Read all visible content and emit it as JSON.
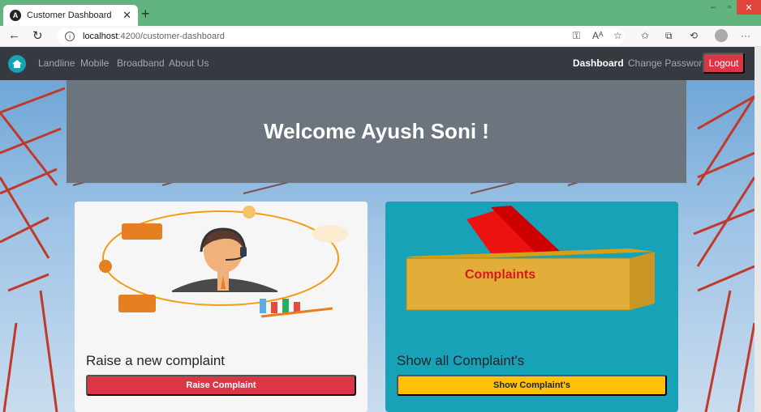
{
  "browser": {
    "tab_title": "Customer Dashboard",
    "tab_icon": "angular-icon",
    "url_host": "localhost",
    "url_path": ":4200/customer-dashboard"
  },
  "navbar": {
    "links": [
      "Landline",
      "Mobile",
      "Broadband",
      "About Us"
    ],
    "right_links": [
      "Dashboard",
      "Change Password"
    ],
    "logout_label": "Logout",
    "colors": {
      "bg": "#343a40",
      "logout": "#dc3545"
    }
  },
  "hero": {
    "welcome": "Welcome Ayush Soni !"
  },
  "cards": {
    "raise": {
      "title": "Raise a new complaint",
      "button": "Raise Complaint"
    },
    "show": {
      "title": "Show all Complaint's",
      "button": "Show Complaint's",
      "box_label": "Complaints"
    }
  }
}
